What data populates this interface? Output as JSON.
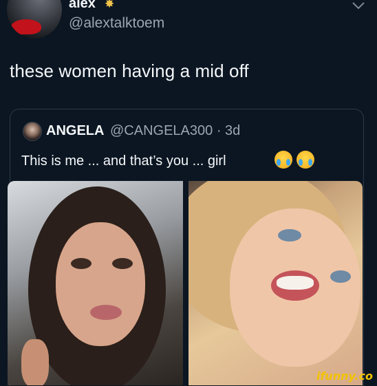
{
  "tweet": {
    "author_name": "alex",
    "author_emoji": "✸",
    "author_handle": "@alextalktoem",
    "text": "these women having a mid off"
  },
  "quote": {
    "author_name": "ANGELA",
    "author_handle": "@CANGELA300 · 3d",
    "text": "This is me ... and that’s you ... girl"
  },
  "watermark": "ifunny.co",
  "colors": {
    "background": "#0b1622",
    "handle": "#9aa6b2",
    "accent_watermark": "#f2c300"
  },
  "icons": [
    "chevron-down-icon",
    "loudly-crying-face-icon",
    "loudly-crying-face-icon"
  ]
}
